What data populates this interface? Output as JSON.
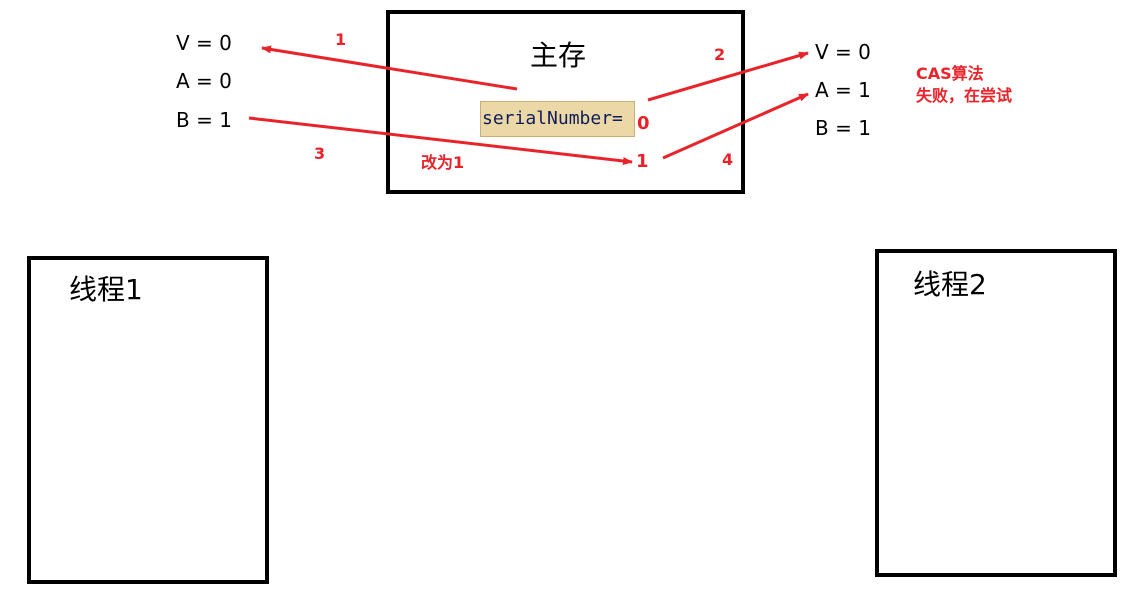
{
  "main_memory": {
    "title": "主存",
    "variable": "serialNumber=",
    "value_initial": "0",
    "value_updated": "1",
    "change_label": "改为1"
  },
  "thread1": {
    "title": "线程1",
    "V": "V = 0",
    "A": "A = 0",
    "B": "B = 1"
  },
  "thread2": {
    "title": "线程2",
    "V": "V = 0",
    "A": "A = 1",
    "B": "B = 1"
  },
  "steps": [
    "1",
    "2",
    "3",
    "4"
  ],
  "cas_note": {
    "line1": "CAS算法",
    "line2": "失败，在尝试"
  },
  "colors": {
    "arrow": "#e8232a",
    "border": "#000000",
    "highlight": "#ecd7a6"
  }
}
